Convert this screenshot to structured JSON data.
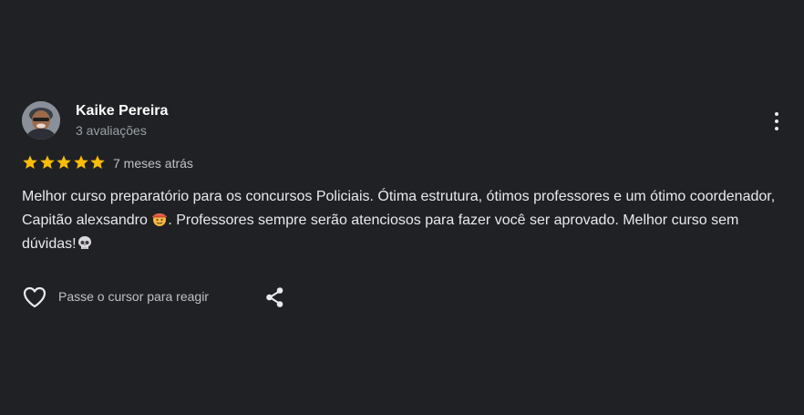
{
  "reviewer": {
    "name": "Kaike Pereira",
    "reviews_count": "3 avaliações",
    "avatar": "reviewer-photo"
  },
  "rating": {
    "stars": 5,
    "max": 5,
    "color": "#fbbc04"
  },
  "time_ago": "7 meses atrás",
  "review_text": {
    "part1": "Melhor curso preparatório para os concursos Policiais. Ótima estrutura, ótimos professores e um ótimo coordenador, Capitão alexsandro ",
    "emoji1": "face-with-cowboy-hat-icon",
    "part2": ". Professores sempre serão atenciosos para fazer você ser aprovado. Melhor curso sem dúvidas!",
    "emoji2": "skull-icon"
  },
  "actions": {
    "react_label": "Passe o cursor para reagir",
    "heart_icon": "heart-outline-icon",
    "share_icon": "share-icon",
    "menu_icon": "more-vertical-icon"
  }
}
